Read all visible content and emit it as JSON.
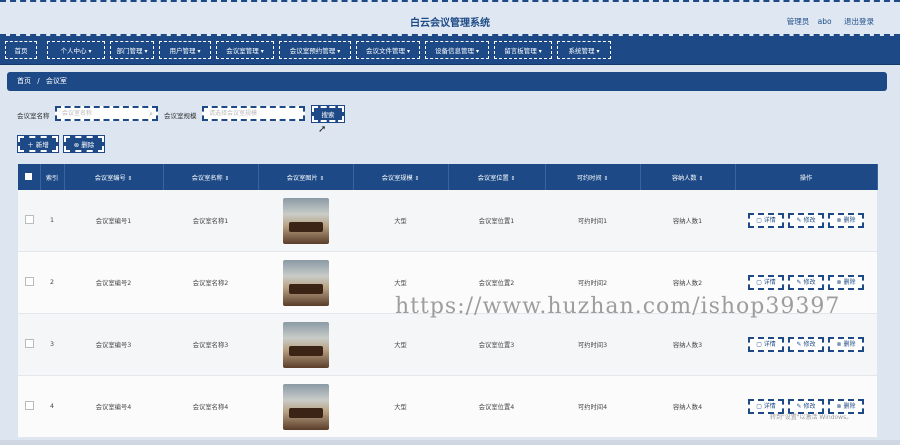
{
  "app_title": "白云会议管理系统",
  "user": {
    "role_label": "管理员",
    "name": "abo",
    "logout": "退出登录"
  },
  "nav": [
    {
      "label": "首页",
      "chev": ""
    },
    {
      "label": "个人中心",
      "chev": "▾"
    },
    {
      "label": "部门管理",
      "chev": "▾"
    },
    {
      "label": "用户管理",
      "chev": "▾"
    },
    {
      "label": "会议室管理",
      "chev": "▾"
    },
    {
      "label": "会议室预约管理",
      "chev": "▾"
    },
    {
      "label": "会议文件管理",
      "chev": "▾"
    },
    {
      "label": "设备信息管理",
      "chev": "▾"
    },
    {
      "label": "留言板管理",
      "chev": "▾"
    },
    {
      "label": "系统管理",
      "chev": "▾"
    }
  ],
  "breadcrumb": {
    "home": "首页",
    "sep": "/",
    "current": "会议室"
  },
  "search": {
    "name_label": "会议室名称",
    "name_placeholder": "会议室名称",
    "scale_label": "会议室规模",
    "scale_placeholder": "请选择会议室规模",
    "search_button": "搜索"
  },
  "actions": {
    "add": "＋ 新增",
    "delete": "⊗ 删除"
  },
  "table": {
    "headers": {
      "index": "索引",
      "code": "会议室编号",
      "name": "会议室名称",
      "image": "会议室图片",
      "scale": "会议室规模",
      "location": "会议室位置",
      "time": "可约时间",
      "capacity": "容纳人数",
      "ops": "操作"
    },
    "sort_glyph": "⇕",
    "ops": {
      "detail": "▢ 详情",
      "edit": "✎ 修改",
      "delete": "⊗ 删除"
    },
    "rows": [
      {
        "index": "1",
        "code": "会议室编号1",
        "name": "会议室名称1",
        "scale": "大型",
        "location": "会议室位置1",
        "time": "可约时间1",
        "capacity": "容纳人数1"
      },
      {
        "index": "2",
        "code": "会议室编号2",
        "name": "会议室名称2",
        "scale": "大型",
        "location": "会议室位置2",
        "time": "可约时间2",
        "capacity": "容纳人数2"
      },
      {
        "index": "3",
        "code": "会议室编号3",
        "name": "会议室名称3",
        "scale": "大型",
        "location": "会议室位置3",
        "time": "可约时间3",
        "capacity": "容纳人数3"
      },
      {
        "index": "4",
        "code": "会议室编号4",
        "name": "会议室名称4",
        "scale": "大型",
        "location": "会议室位置4",
        "time": "可约时间4",
        "capacity": "容纳人数4"
      }
    ]
  },
  "watermark": "https://www.huzhan.com/ishop39397",
  "windows_notice": "转到\"设置\"以激活 Windows。"
}
